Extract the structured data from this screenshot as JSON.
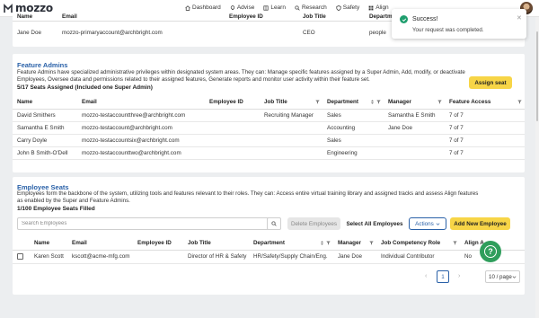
{
  "app": {
    "logo": "mozzo"
  },
  "nav": [
    {
      "label": "Dashboard",
      "icon": "home-icon"
    },
    {
      "label": "Advise",
      "icon": "lightbulb-icon"
    },
    {
      "label": "Learn",
      "icon": "book-icon"
    },
    {
      "label": "Research",
      "icon": "search-icon"
    },
    {
      "label": "Safety",
      "icon": "shield-icon"
    },
    {
      "label": "Align",
      "icon": "grid-icon"
    }
  ],
  "super_admin": {
    "columns": [
      "Name",
      "Email",
      "Employee ID",
      "Job Title",
      "Departm"
    ],
    "rows": [
      {
        "name": "Jane Doe",
        "email": "mozzo-primaryaccount@archbright.com",
        "employee_id": "",
        "job_title": "CEO",
        "department": "people"
      }
    ]
  },
  "feature_admins": {
    "title": "Feature Admins",
    "description": "Feature Admins have specialized administrative privileges within designated system areas. They can: Manage specific features assigned by a Super Admin, Add, modify, or deactivate Employees, Oversee data and permissions related to their assigned features, Generate reports and monitor user activity within their feature set.",
    "count": "5/17 Seats Assigned (Included one Super Admin)",
    "assign_button": "Assign seat",
    "columns": [
      "Name",
      "Email",
      "Employee ID",
      "Job Title",
      "Department",
      "Manager",
      "Feature Access"
    ],
    "rows": [
      {
        "name": "David Smithers",
        "email": "mozzo-testaccountthree@archbright.com",
        "employee_id": "",
        "job_title": "Recruiting Manager",
        "department": "Sales",
        "manager": "Samantha E Smith",
        "access": "7 of 7"
      },
      {
        "name": "Samantha E Smith",
        "email": "mozzo-testaccount@archbright.com",
        "employee_id": "",
        "job_title": "",
        "department": "Accounting",
        "manager": "Jane Doe",
        "access": "7 of 7"
      },
      {
        "name": "Carry Doyle",
        "email": "mozzo-testaccountsix@archbright.com",
        "employee_id": "",
        "job_title": "",
        "department": "Sales",
        "manager": "",
        "access": "7 of 7"
      },
      {
        "name": "John B Smith-O'Dell",
        "email": "mozzo-testaccounttwo@archbright.com",
        "employee_id": "",
        "job_title": "",
        "department": "Engineering",
        "manager": "",
        "access": "7 of 7"
      }
    ]
  },
  "employee_seats": {
    "title": "Employee Seats",
    "description": "Employees form the backbone of the system, utilizing tools and features relevant to their roles. They can: Access entire virtual training library and assigned tracks and assess Align features as enabled by the Super and Feature Admins.",
    "count": "1/100 Employee Seats Filled",
    "search_placeholder": "Search Employees",
    "delete_button": "Delete Employees",
    "select_all_button": "Select All Employees",
    "actions_button": "Actions",
    "add_button": "Add New Employee",
    "columns": [
      "Name",
      "Email",
      "Employee ID",
      "Job Title",
      "Department",
      "Manager",
      "Job Competency Role",
      "Align A"
    ],
    "rows": [
      {
        "name": "Karen Scott",
        "email": "kscott@acme-mfg.com",
        "employee_id": "",
        "job_title": "Director of HR & Safety",
        "department": "HR/Safety/Supply Chain/Eng.",
        "manager": "Jane Doe",
        "role": "Individual Contributor",
        "align": "No"
      }
    ],
    "page": "1",
    "page_size": "10 / page"
  },
  "toast": {
    "title": "Success!",
    "message": "Your request was completed."
  },
  "colors": {
    "accent": "#2a61a8",
    "button_yellow": "#f7d547",
    "success": "#1f9e6e",
    "help": "#2f9e5c"
  }
}
